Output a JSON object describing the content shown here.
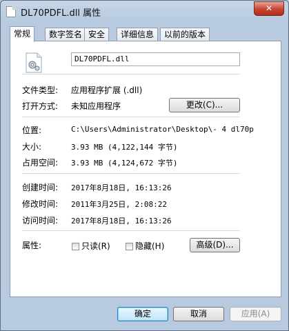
{
  "window": {
    "title": "DL70PDFL.dll 属性",
    "close_label": "✕"
  },
  "tabs": [
    "常规",
    "数字签名",
    "安全",
    "详细信息",
    "以前的版本"
  ],
  "general": {
    "filename": "DL70PDFL.dll",
    "file_type_label": "文件类型:",
    "file_type_value": "应用程序扩展 (.dll)",
    "open_with_label": "打开方式:",
    "open_with_value": "未知应用程序",
    "change_button": "更改(C)...",
    "location_label": "位置:",
    "location_value": "C:\\Users\\Administrator\\Desktop\\-  4 dl70p",
    "size_label": "大小:",
    "size_value": "3.93 MB (4,122,144 字节)",
    "size_on_disk_label": "占用空间:",
    "size_on_disk_value": "3.93 MB (4,124,672 字节)",
    "created_label": "创建时间:",
    "created_value": "2017年8月18日, 16:13:26",
    "modified_label": "修改时间:",
    "modified_value": "2011年3月25日, 2:08:22",
    "accessed_label": "访问时间:",
    "accessed_value": "2017年8月18日, 16:13:26",
    "attributes_label": "属性:",
    "readonly_label": "只读(R)",
    "hidden_label": "隐藏(H)",
    "advanced_button": "高级(D)..."
  },
  "footer": {
    "ok": "确定",
    "cancel": "取消",
    "apply": "应用(A)"
  }
}
